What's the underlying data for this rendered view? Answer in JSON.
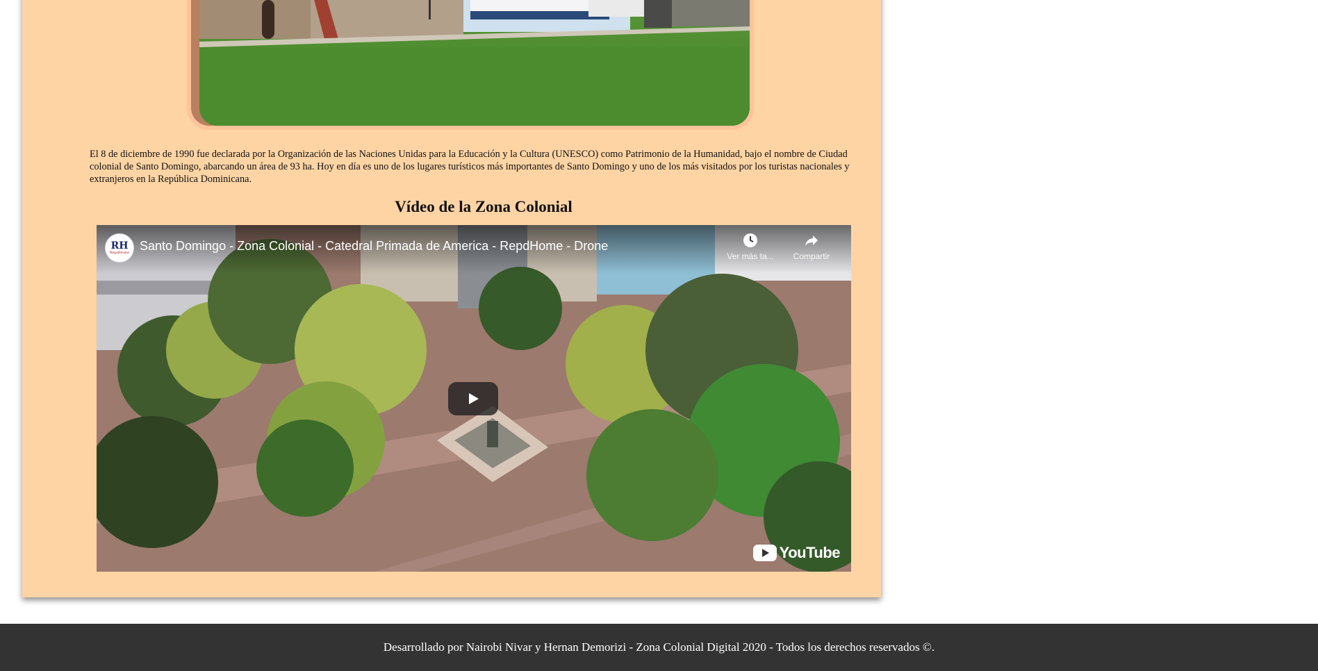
{
  "content": {
    "paragraph": "El 8 de diciembre de 1990 fue declarada por la Organización de las Naciones Unidas para la Educación y la Cultura (UNESCO) como Patrimonio de la Humanidad, bajo el nombre de Ciudad colonial de Santo Domingo, abarcando un área de 93 ha. Hoy en día es uno de los lugares turísticos más importantes de Santo Domingo y uno de los más visitados por los turistas nacionales y extranjeros en la República Dominicana.",
    "video_heading": "Vídeo de la Zona Colonial"
  },
  "video": {
    "title": "Santo Domingo - Zona Colonial - Catedral Primada de America - RepdHome - Drone",
    "channel_initials": "RH",
    "channel_sub": "RepdHome",
    "watch_later_label": "Ver más ta...",
    "share_label": "Compartir",
    "platform_logo": "YouTube"
  },
  "footer": {
    "text": "Desarrollado por Nairobi Nivar y Hernan Demorizi - Zona Colonial Digital 2020 - Todos los derechos reservados ©."
  },
  "colors": {
    "card_background": "#fed4a4",
    "footer_background": "#333333",
    "page_background": "#ffffff"
  },
  "icons": [
    "play-icon",
    "clock-icon",
    "share-icon",
    "youtube-logo-icon"
  ]
}
